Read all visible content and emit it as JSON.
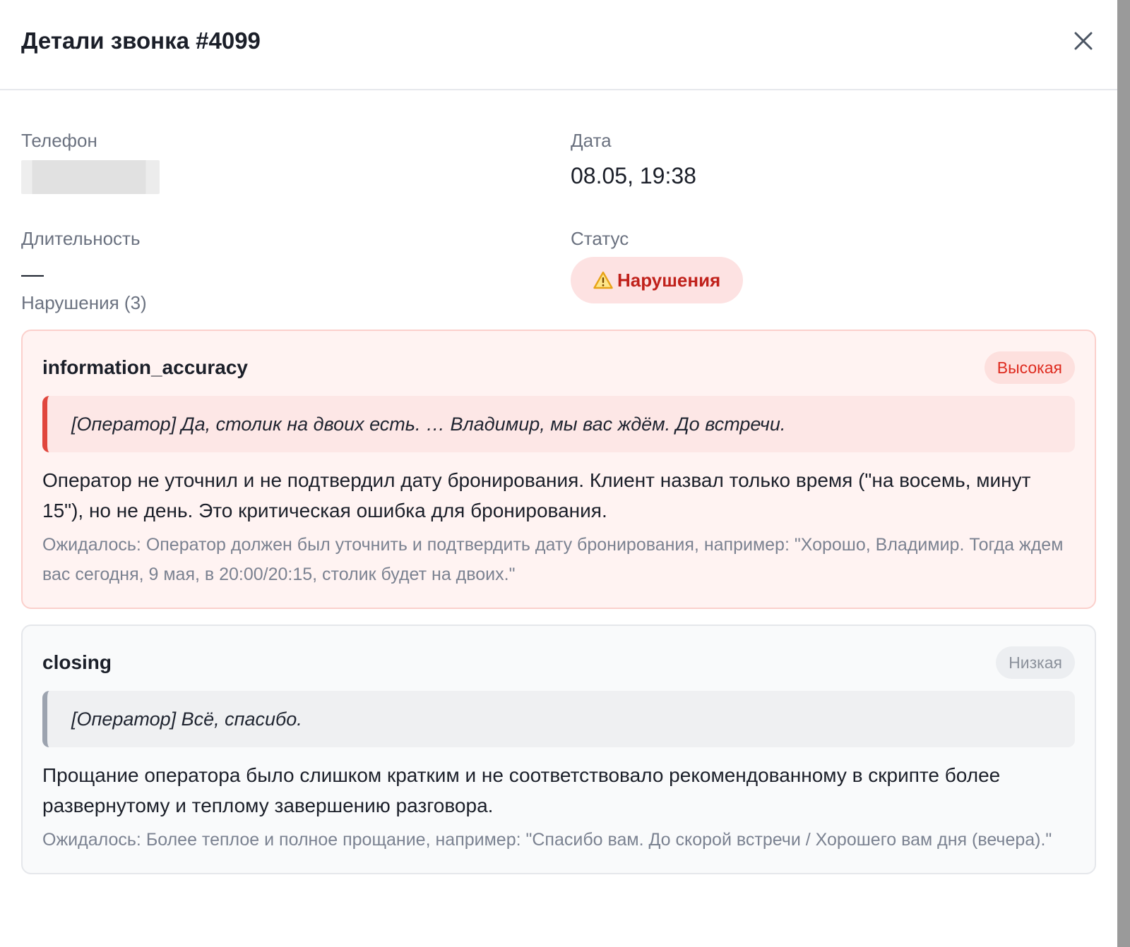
{
  "modal": {
    "title": "Детали звонка #4099",
    "close_icon": "close-icon"
  },
  "info": {
    "phone_label": "Телефон",
    "date_label": "Дата",
    "date_value": "08.05, 19:38",
    "duration_label": "Длительность",
    "duration_value": "—",
    "status_label": "Статус",
    "status_value": "Нарушения",
    "status_icon": "warning-icon"
  },
  "violations_title": "Нарушения (3)",
  "violations": [
    {
      "name": "information_accuracy",
      "severity": "Высокая",
      "quote": "[Оператор] Да, столик на двоих есть. … Владимир, мы вас ждём. До встречи.",
      "description": "Оператор не уточнил и не подтвердил дату бронирования. Клиент назвал только время (\"на восемь, минут 15\"), но не день. Это критическая ошибка для бронирования.",
      "expected": "Ожидалось: Оператор должен был уточнить и подтвердить дату бронирования, например: \"Хорошо, Владимир. Тогда ждем вас сегодня, 9 мая, в 20:00/20:15, столик будет на двоих.\""
    },
    {
      "name": "closing",
      "severity": "Низкая",
      "quote": "[Оператор] Всё, спасибо.",
      "description": "Прощание оператора было слишком кратким и не соответствовало рекомендованному в скрипте более развернутому и теплому завершению разговора.",
      "expected": "Ожидалось: Более теплое и полное прощание, например: \"Спасибо вам. До скорой встречи / Хорошего вам дня (вечера).\""
    }
  ],
  "colors": {
    "danger": "#de2b1f",
    "danger_bg": "#fff3f2",
    "muted": "#6b7280"
  }
}
